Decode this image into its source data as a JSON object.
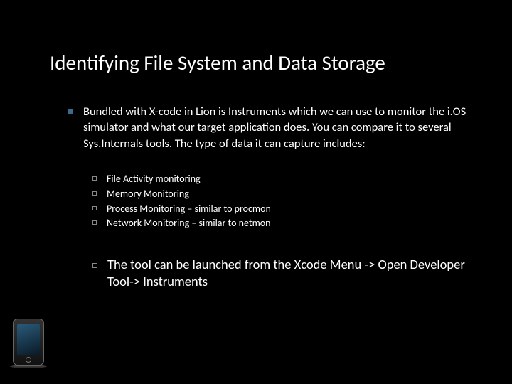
{
  "title": "Identifying File System and Data Storage",
  "main_bullet": "Bundled with X-code in Lion is Instruments which we can use to monitor the i.OS simulator and what our target application does. You can compare it to several Sys.Internals tools.  The type of data it can capture includes:",
  "sub_items": [
    "File Activity monitoring",
    "Memory Monitoring",
    "Process Monitoring – similar to procmon",
    "Network Monitoring – similar to netmon"
  ],
  "launch_text": "The tool can be launched from the Xcode Menu -> Open Developer Tool-> Instruments"
}
